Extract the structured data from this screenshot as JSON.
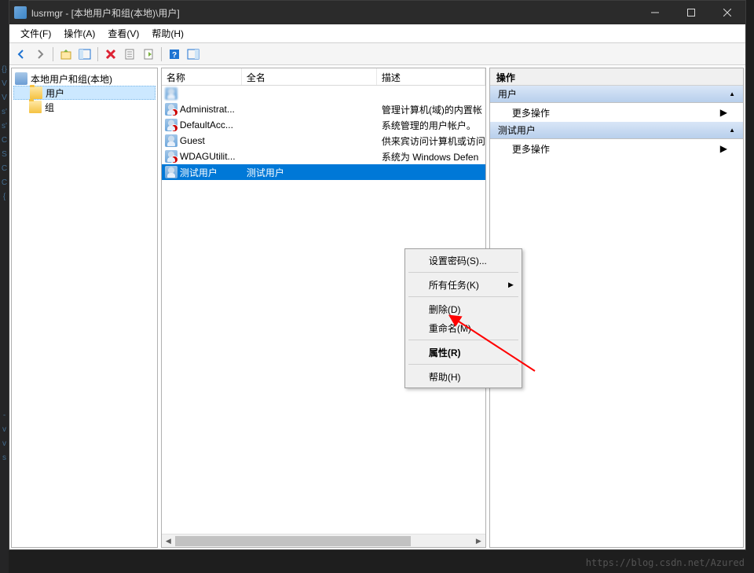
{
  "titlebar": {
    "title": "lusrmgr - [本地用户和组(本地)\\用户]"
  },
  "menu": {
    "file": "文件(F)",
    "action": "操作(A)",
    "view": "查看(V)",
    "help": "帮助(H)"
  },
  "tree": {
    "root": "本地用户和组(本地)",
    "users": "用户",
    "groups": "组"
  },
  "columns": {
    "name": "名称",
    "fullname": "全名",
    "desc": "描述"
  },
  "users": [
    {
      "name": "",
      "full": "",
      "desc": "",
      "blur": true
    },
    {
      "name": "Administrat...",
      "full": "",
      "desc": "管理计算机(域)的内置帐"
    },
    {
      "name": "DefaultAcc...",
      "full": "",
      "desc": "系统管理的用户帐户。"
    },
    {
      "name": "Guest",
      "full": "",
      "desc": "供来宾访问计算机或访问"
    },
    {
      "name": "WDAGUtilit...",
      "full": "",
      "desc": "系统为 Windows Defen"
    },
    {
      "name": "测试用户",
      "full": "测试用户",
      "desc": "",
      "sel": true
    }
  ],
  "context": {
    "set_password": "设置密码(S)...",
    "all_tasks": "所有任务(K)",
    "delete": "删除(D)",
    "rename": "重命名(M)",
    "properties": "属性(R)",
    "help": "帮助(H)"
  },
  "actions": {
    "header": "操作",
    "section_users": "用户",
    "more1": "更多操作",
    "section_test": "测试用户",
    "more2": "更多操作"
  },
  "watermark": "https://blog.csdn.net/Azured"
}
